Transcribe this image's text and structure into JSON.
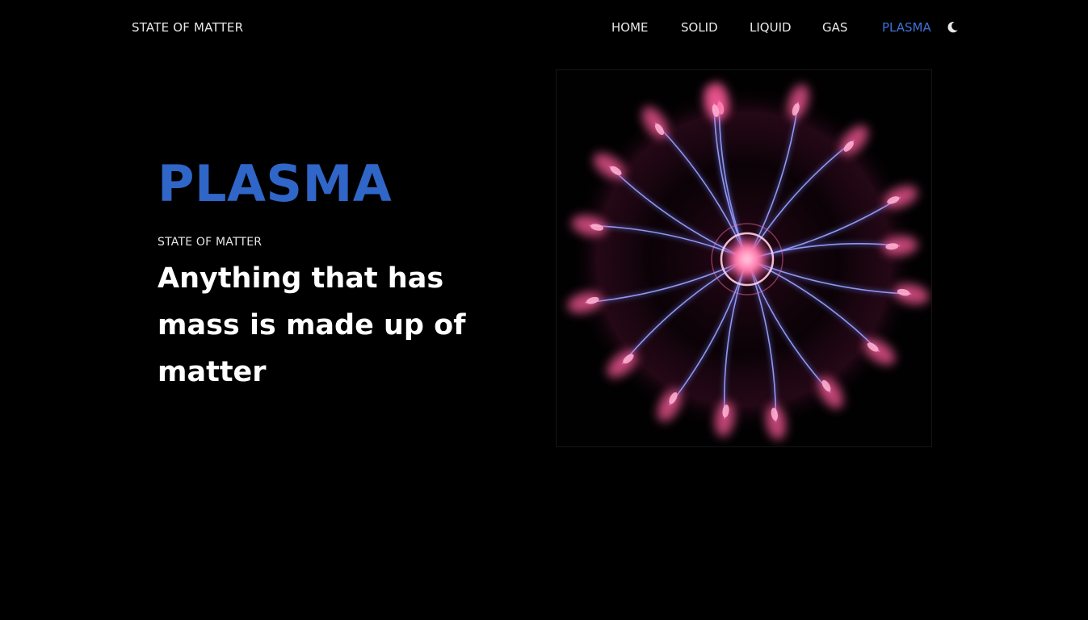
{
  "header": {
    "brand": "STATE OF MATTER",
    "nav": {
      "home": "HOME",
      "solid": "SOLID",
      "liquid": "LIQUID",
      "gas": "GAS",
      "plasma": "PLASMA",
      "active": "PLASMA"
    },
    "theme_toggle_icon": "moon-icon"
  },
  "hero": {
    "title": "PLASMA",
    "kicker": "STATE OF MATTER",
    "tagline": "Anything that has mass is made up of matter",
    "image_subject": "plasma-ball-image"
  },
  "colors": {
    "background": "#000000",
    "accent": "#2f66c8",
    "nav_active": "#3d73d8",
    "text": "#ffffff",
    "plasma_pink": "#ff5c9a",
    "plasma_blue": "#6f7bff"
  }
}
